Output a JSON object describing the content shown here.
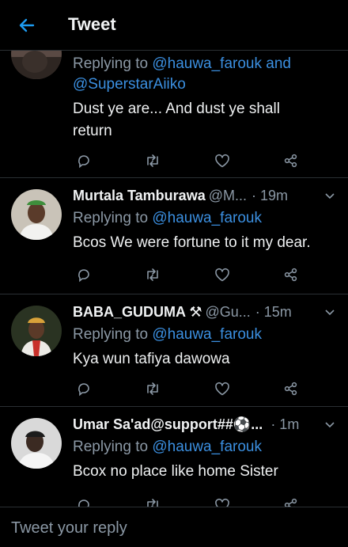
{
  "header": {
    "title": "Tweet",
    "back_icon": "arrow-left-icon"
  },
  "colors": {
    "background": "#000000",
    "accent": "#1d9bf0",
    "mention": "#3b8fe0",
    "muted": "#8b98a5",
    "divider": "#2a2f33"
  },
  "tweets": [
    {
      "name": "",
      "handle": "",
      "time": "",
      "replying_prefix": "Replying to ",
      "replying_mention": "@hauwa_farouk and @SuperstarAiiko",
      "text": "Dust ye are... And dust ye shall return"
    },
    {
      "name": "Murtala Tamburawa",
      "handle": "@M...",
      "time": "· 19m",
      "replying_prefix": "Replying to ",
      "replying_mention": "@hauwa_farouk",
      "text": "Bcos We were fortune to it my dear."
    },
    {
      "name": "BABA_GUDUMA ⚒",
      "handle": "@Gu...",
      "time": "· 15m",
      "replying_prefix": "Replying to ",
      "replying_mention": "@hauwa_farouk",
      "text": "Kya wun tafiya dawowa"
    },
    {
      "name": "Umar Sa'ad@support##⚽...",
      "handle": "",
      "time": "· 1m",
      "replying_prefix": "Replying to ",
      "replying_mention": "@hauwa_farouk",
      "text": "Bcox no place like home Sister"
    }
  ],
  "action_icons": [
    "reply-icon",
    "retweet-icon",
    "like-icon",
    "share-icon"
  ],
  "reply_bar": {
    "placeholder": "Tweet your reply"
  }
}
